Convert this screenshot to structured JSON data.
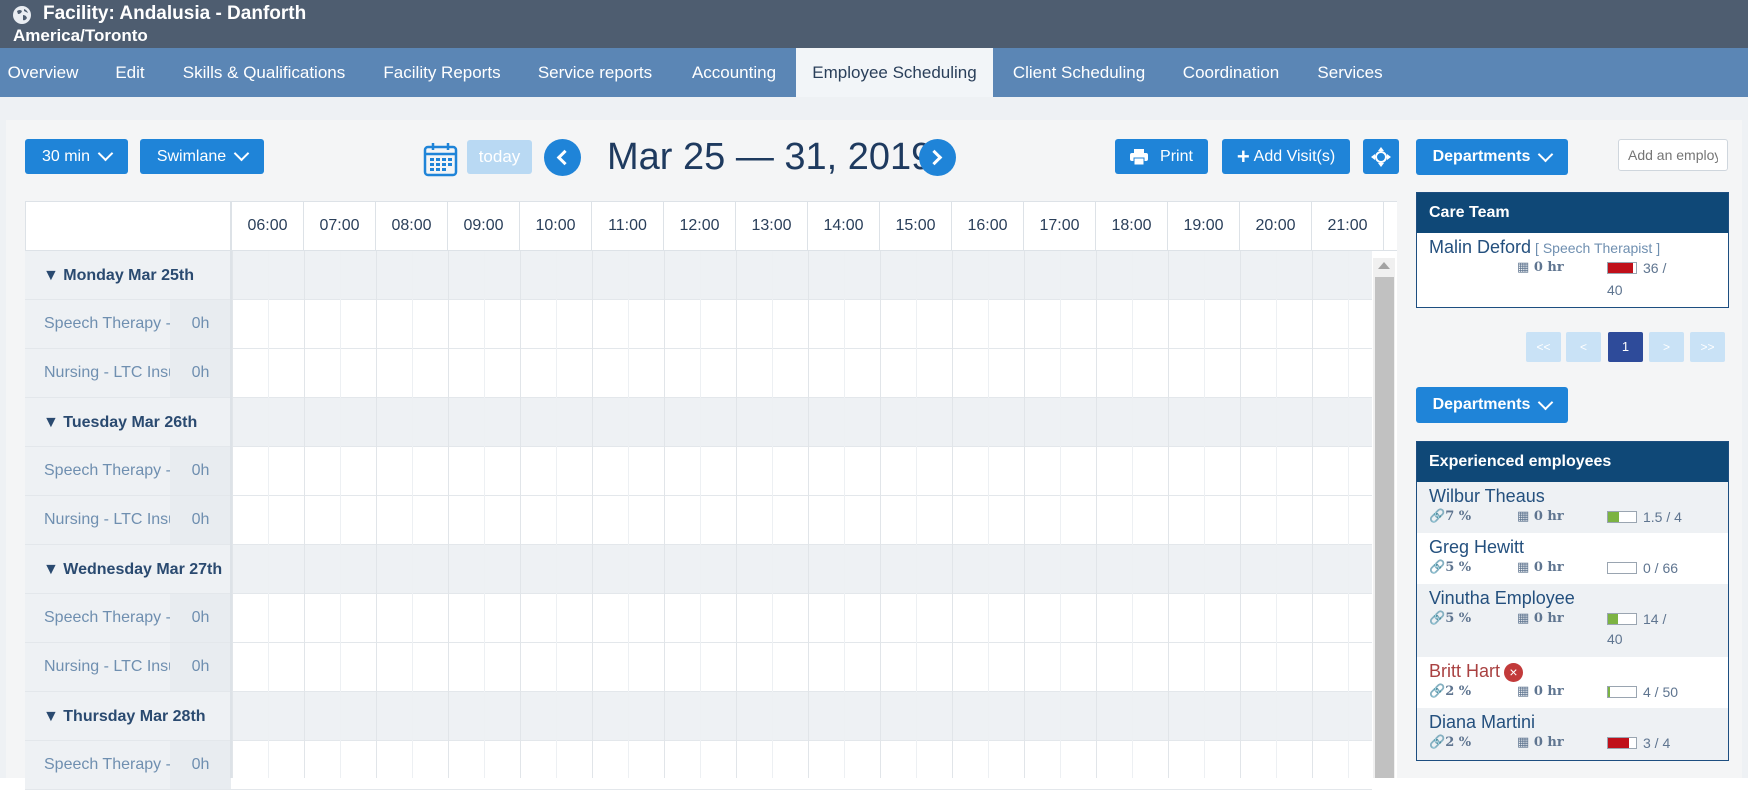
{
  "header": {
    "facility_title": "Facility: Andalusia - Danforth",
    "timezone": "America/Toronto",
    "globe_icon": "globe-icon"
  },
  "nav": {
    "tabs": [
      {
        "label": "Overview"
      },
      {
        "label": "Edit"
      },
      {
        "label": "Skills & Qualifications"
      },
      {
        "label": "Facility Reports"
      },
      {
        "label": "Service reports"
      },
      {
        "label": "Accounting"
      },
      {
        "label": "Employee Scheduling",
        "active": true
      },
      {
        "label": "Client Scheduling"
      },
      {
        "label": "Coordination"
      },
      {
        "label": "Services"
      }
    ]
  },
  "toolbar": {
    "interval_label": "30 min",
    "view_label": "Swimlane",
    "today_label": "today",
    "date_range": "Mar 25 — 31, 2019",
    "print_label": "Print",
    "add_visit_label": "Add Visit(s)",
    "departments_label": "Departments",
    "add_employee_placeholder": "Add an employee"
  },
  "schedule": {
    "hours": [
      "06:00",
      "07:00",
      "08:00",
      "09:00",
      "10:00",
      "11:00",
      "12:00",
      "13:00",
      "14:00",
      "15:00",
      "16:00",
      "17:00",
      "18:00",
      "19:00",
      "20:00",
      "21:00"
    ],
    "days": [
      {
        "label": "Monday Mar 25th",
        "services": [
          {
            "name": "Speech Therapy - ",
            "hours": "0h"
          },
          {
            "name": "Nursing - LTC Insu",
            "hours": "0h"
          }
        ]
      },
      {
        "label": "Tuesday Mar 26th",
        "services": [
          {
            "name": "Speech Therapy - ",
            "hours": "0h"
          },
          {
            "name": "Nursing - LTC Insu",
            "hours": "0h"
          }
        ]
      },
      {
        "label": "Wednesday Mar 27th",
        "services": [
          {
            "name": "Speech Therapy - ",
            "hours": "0h"
          },
          {
            "name": "Nursing - LTC Insu",
            "hours": "0h"
          }
        ]
      },
      {
        "label": "Thursday Mar 28th",
        "services": [
          {
            "name": "Speech Therapy - ",
            "hours": "0h"
          }
        ]
      }
    ]
  },
  "care_team": {
    "title": "Care Team",
    "members": [
      {
        "name": "Malin Deford",
        "role": "[ Speech Therapist ]",
        "hr": "0 hr",
        "quota": "36 /",
        "quota2": "40",
        "fill": 0.9,
        "color": "#c0101a"
      }
    ]
  },
  "pager": {
    "first": "<<",
    "prev": "<",
    "current": "1",
    "next": ">",
    "last": ">>"
  },
  "experienced": {
    "departments_label": "Departments",
    "title": "Experienced employees",
    "employees": [
      {
        "name": "Wilbur Theaus",
        "pct": "7 %",
        "hr": "0 hr",
        "quota": "1.5 / 4",
        "fill": 0.375,
        "color": "#7cb342"
      },
      {
        "name": "Greg Hewitt",
        "pct": "5 %",
        "hr": "0 hr",
        "quota": "0 / 66",
        "fill": 0,
        "color": "#7cb342"
      },
      {
        "name": "Vinutha Employee",
        "pct": "5 %",
        "hr": "0 hr",
        "quota": "14 /",
        "quota2": "40",
        "fill": 0.35,
        "color": "#7cb342"
      },
      {
        "name": "Britt Hart",
        "pct": "2 %",
        "hr": "0 hr",
        "quota": "4 / 50",
        "fill": 0.08,
        "color": "#7cb342",
        "warning": true
      },
      {
        "name": "Diana Martini",
        "pct": "2 %",
        "hr": "0 hr",
        "quota": "3 / 4",
        "fill": 0.75,
        "color": "#c0101a"
      }
    ]
  }
}
